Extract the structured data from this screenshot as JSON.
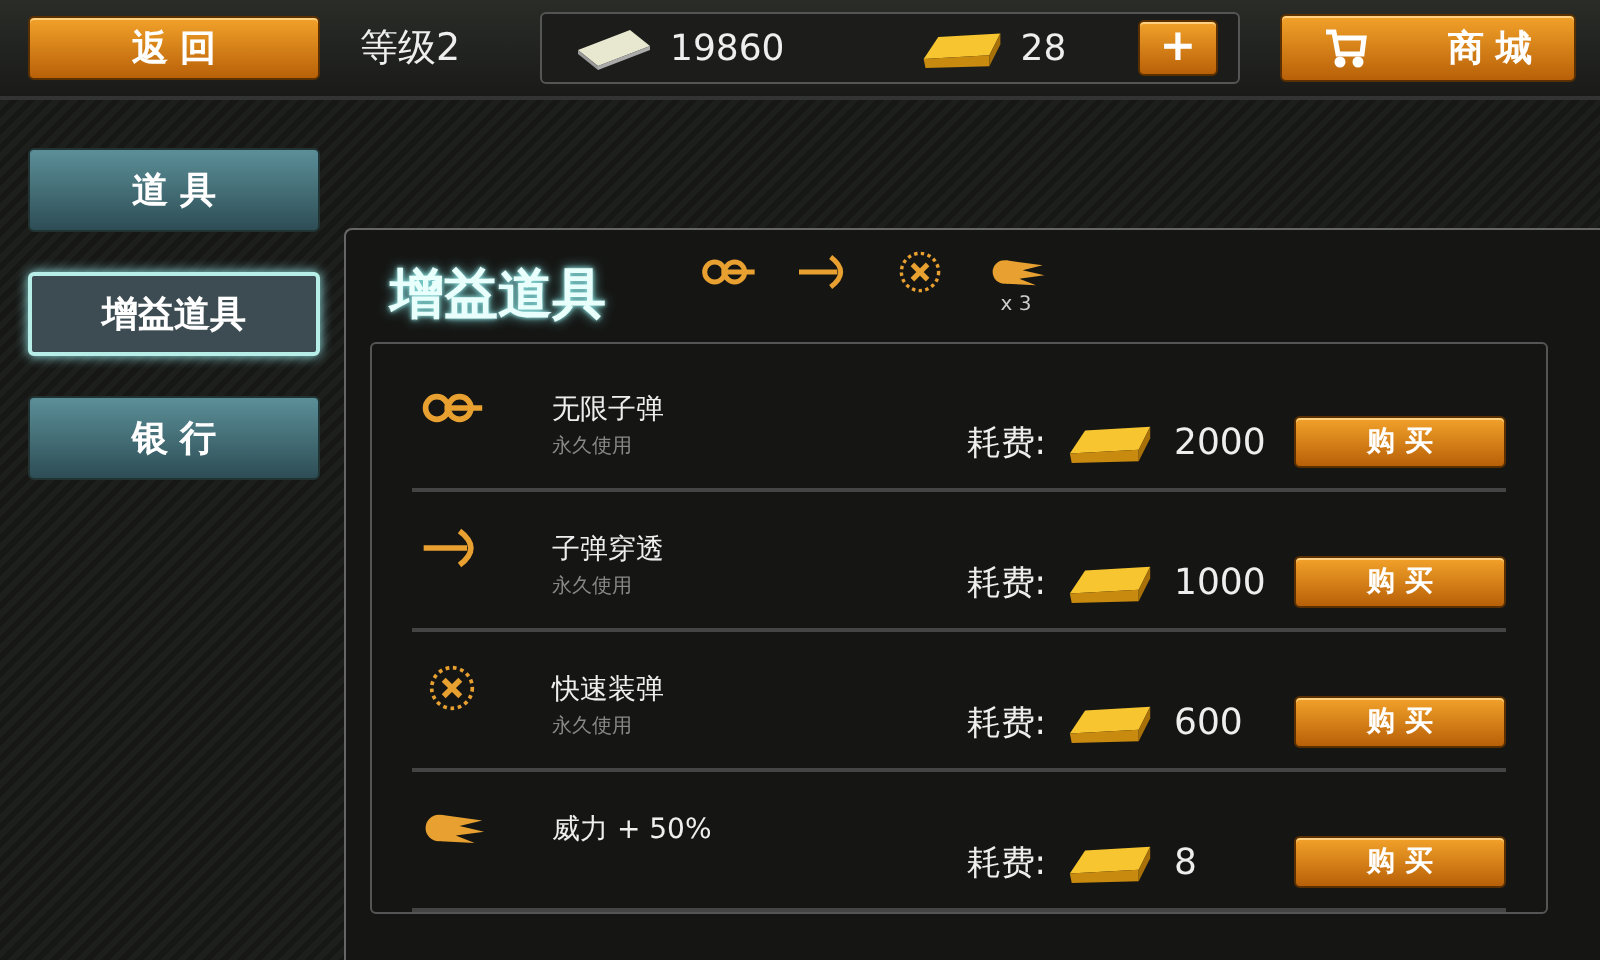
{
  "top_bar": {
    "back_button": "返 回",
    "level": "等级2",
    "cash": "19860",
    "gold": "28",
    "add_button": "+",
    "shop_button": "商 城"
  },
  "sidebar": {
    "items": [
      {
        "label": "道 具",
        "selected": false
      },
      {
        "label": "增益道具",
        "selected": true
      },
      {
        "label": "银 行",
        "selected": false
      }
    ]
  },
  "panel": {
    "title": "增益道具",
    "active_boosts": [
      {
        "kind": "infinite"
      },
      {
        "kind": "pierce"
      },
      {
        "kind": "reload"
      },
      {
        "kind": "power",
        "count": "x 3"
      }
    ],
    "items": [
      {
        "kind": "infinite",
        "name": "无限子弹",
        "subtitle": "永久使用",
        "cost_label": "耗费:",
        "price": "2000",
        "buy_button": "购 买"
      },
      {
        "kind": "pierce",
        "name": "子弹穿透",
        "subtitle": "永久使用",
        "cost_label": "耗费:",
        "price": "1000",
        "buy_button": "购 买"
      },
      {
        "kind": "reload",
        "name": "快速装弹",
        "subtitle": "永久使用",
        "cost_label": "耗费:",
        "price": "600",
        "buy_button": "购 买"
      },
      {
        "kind": "power",
        "name": "威力 + 50%",
        "cost_label": "耗费:",
        "price": "8",
        "buy_button": "购 买"
      }
    ]
  }
}
